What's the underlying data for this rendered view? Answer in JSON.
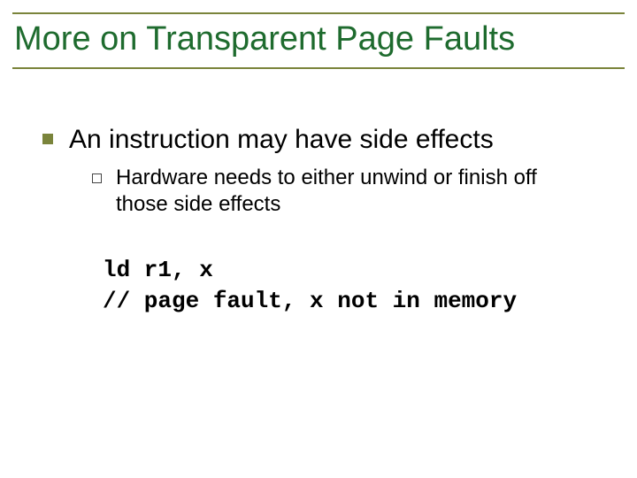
{
  "title": "More on Transparent Page Faults",
  "l1": {
    "text": "An instruction may have side effects"
  },
  "l2": {
    "text": "Hardware needs to either unwind or finish off those side effects"
  },
  "code": {
    "line1": "ld r1, x",
    "line2": "// page fault, x not in memory"
  }
}
